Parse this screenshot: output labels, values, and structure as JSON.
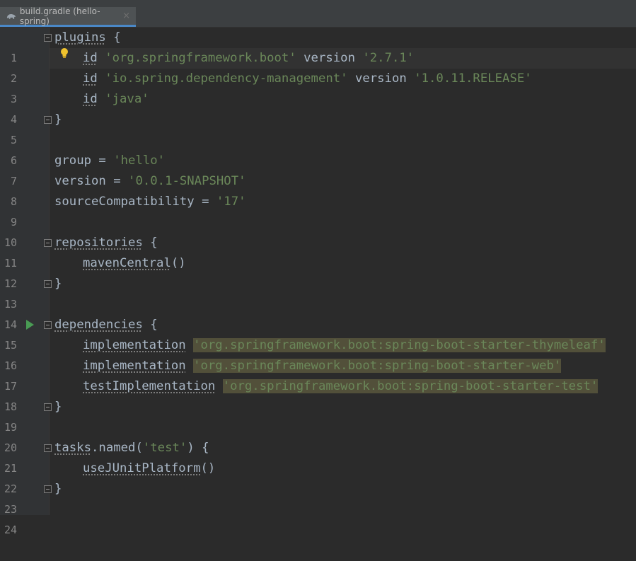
{
  "tab": {
    "title": "build.gradle (hello-spring)",
    "close": "×"
  },
  "line_numbers": [
    "1",
    "2",
    "3",
    "4",
    "5",
    "6",
    "7",
    "8",
    "9",
    "10",
    "11",
    "12",
    "13",
    "14",
    "15",
    "16",
    "17",
    "18",
    "19",
    "20",
    "21",
    "22",
    "23",
    "24"
  ],
  "code": {
    "l1": {
      "kw": "plugins",
      "rest": " {"
    },
    "l2": {
      "kw": "id",
      "s1": "'org.springframework.boot'",
      "mid": " version ",
      "s2": "'2.7.1'"
    },
    "l3": {
      "kw": "id",
      "s1": "'io.spring.dependency-management'",
      "mid": " version ",
      "s2": "'1.0.11.RELEASE'"
    },
    "l4": {
      "kw": "id",
      "s1": "'java'"
    },
    "l5": {
      "text": "}"
    },
    "l7": {
      "key": "group = ",
      "val": "'hello'"
    },
    "l8": {
      "key": "version = ",
      "val": "'0.0.1-SNAPSHOT'"
    },
    "l9": {
      "key": "sourceCompatibility = ",
      "val": "'17'"
    },
    "l11": {
      "kw": "repositories",
      "rest": " {"
    },
    "l12": {
      "kw": "mavenCentral",
      "rest": "()"
    },
    "l13": {
      "text": "}"
    },
    "l15": {
      "kw": "dependencies",
      "rest": " {"
    },
    "l16": {
      "kw": "implementation",
      "val": "'org.springframework.boot:spring-boot-starter-thymeleaf'"
    },
    "l17": {
      "kw": "implementation",
      "val": "'org.springframework.boot:spring-boot-starter-web'"
    },
    "l18": {
      "kw": "testImplementation",
      "val": "'org.springframework.boot:spring-boot-starter-test'"
    },
    "l19": {
      "text": "}"
    },
    "l21": {
      "kw": "tasks",
      "pre": ".named(",
      "val": "'test'",
      "rest": ") {"
    },
    "l22": {
      "kw": "useJUnitPlatform",
      "rest": "()"
    },
    "l23": {
      "text": "}"
    }
  },
  "colors": {
    "background": "#2b2b2b",
    "text": "#a9b7c6",
    "string": "#6a8759",
    "highlight": "#52503a",
    "gutter": "#313335"
  },
  "icons": {
    "tab": "gradle-elephant-icon",
    "bulb": "lightbulb-icon",
    "run": "run-gutter-icon"
  }
}
